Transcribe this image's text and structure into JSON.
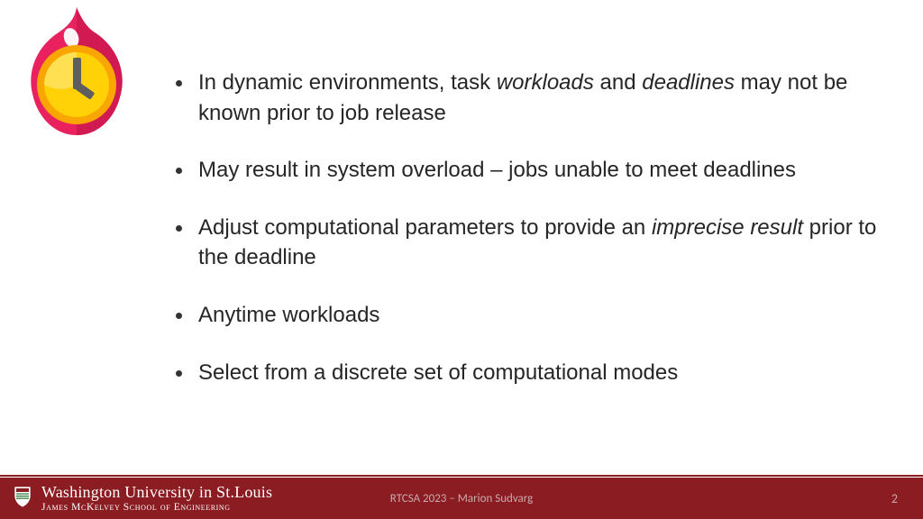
{
  "bullets": [
    {
      "html": "In dynamic environments, task <em>workloads</em> and <em>deadlines</em> may not be known prior to job release"
    },
    {
      "html": "May result in system overload – jobs unable to meet deadlines"
    },
    {
      "html": "Adjust computational parameters to provide an <em>imprecise result</em> prior to the deadline"
    },
    {
      "html": "Anytime workloads"
    },
    {
      "html": "Select from a discrete set of computational modes"
    }
  ],
  "footer": {
    "university_top": "Washington University in St.Louis",
    "university_bottom": "James McKelvey School of Engineering",
    "center": "RTCSA 2023 – Marion Sudvarg",
    "page": "2"
  },
  "colors": {
    "footer_bg": "#8a1c22",
    "flame_outer": "#e9215e",
    "flame_outer_dark": "#d11a52",
    "clock_face": "#ffd106",
    "clock_ring": "#f9a602",
    "hand": "#5e5e5e"
  }
}
